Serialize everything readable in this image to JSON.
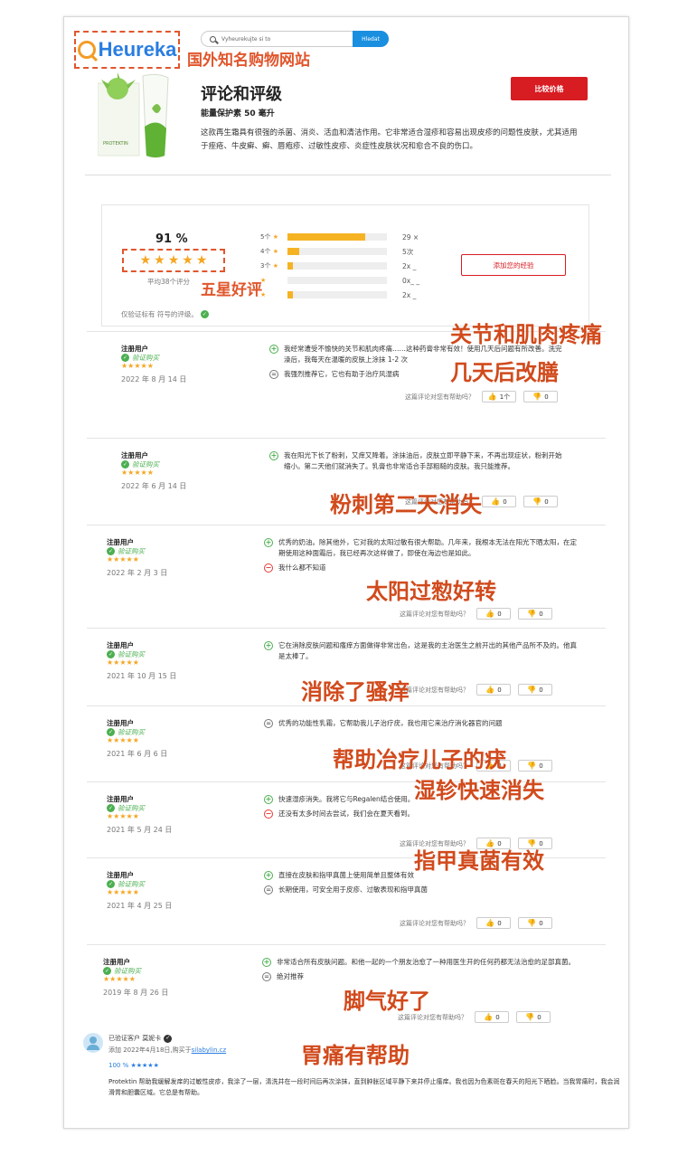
{
  "header": {
    "logo_text": "Heureka",
    "logo_annotation": "国外知名购物网站",
    "search_placeholder": "Vyheurekujte si to",
    "search_button": "Hledat",
    "title": "评论和评级",
    "subtitle": "能量保护素 50 毫升",
    "description": "这款再生霜具有很强的杀菌、消炎、活血和清洁作用。它非常适合湿疹和容易出现皮疹的问题性皮肤，尤其适用于痤疮、牛皮癣、癣、唇疱疹、过敏性皮疹、炎症性皮肤状况和愈合不良的伤口。",
    "compare_button": "比较价格",
    "product_label": "PROTEKTIN"
  },
  "summary": {
    "percent": "91 %",
    "stars_annotation": "五星好评",
    "average": "平均38个评分",
    "verified_note": "仅验证标有 符号的评级。",
    "add_button": "添加您的经验",
    "bars": [
      {
        "label": "5个",
        "fraction": 0.78,
        "count": "29 ×"
      },
      {
        "label": "4个",
        "fraction": 0.12,
        "count": "5次"
      },
      {
        "label": "3个",
        "fraction": 0.05,
        "count": "2x _"
      },
      {
        "label": "",
        "fraction": 0.0,
        "count": "0x_ _"
      },
      {
        "label": "",
        "fraction": 0.05,
        "count": "2x _"
      }
    ]
  },
  "helpful_question": "这篇评论对您有帮助吗？",
  "reviews": [
    {
      "user": "注册用户",
      "verified": "验证购买",
      "stars": "★★★★★",
      "date": "2022 年 8 月 14 日",
      "lines": [
        {
          "type": "plus",
          "text": "我经常遭受不愉快的关节和肌肉疼痛……这种药膏非常有效！使用几天后问题有所改善。洗完澡后，我每天在温暖的皮肤上涂抹 1-2 次"
        },
        {
          "type": "eq",
          "text": "我强烈推荐它，它也有助于治疗风湿病"
        }
      ],
      "up": "1个",
      "down": "0"
    },
    {
      "user": "注册用户",
      "verified": "验证购买",
      "stars": "★★★★★",
      "date": "2022 年 6 月 14 日",
      "lines": [
        {
          "type": "plus",
          "text": "我在阳光下长了粉刺，又痒又降着。涂抹油后，皮肤立即平静下来，不再出现症状，粉刺开始缩小。第二天他们就消失了。乳膏也非常适合手部粗糙的皮肤。我只能推荐。"
        }
      ],
      "up": "0",
      "down": "0"
    },
    {
      "user": "注册用户",
      "verified": "验证购买",
      "stars": "★★★★★",
      "date": "2022 年 2 月 3 日",
      "lines": [
        {
          "type": "plus",
          "text": "优秀的奶油。除其他外，它对我的太阳过敏有很大帮助。几年来，我根本无法在阳光下晒太阳，在定期使用这种面霜后，我已经再次这样做了，即使在海边也是如此。"
        },
        {
          "type": "minus",
          "text": "我什么都不知道"
        }
      ],
      "up": "0",
      "down": "0"
    },
    {
      "user": "注册用户",
      "verified": "验证购买",
      "stars": "★★★★★",
      "date": "2021 年 10 月 15 日",
      "lines": [
        {
          "type": "plus",
          "text": "它在消除皮肤问题和瘙痒方面做得非常出色，这是我的主治医生之前开出的其他产品所不及的。他真是太棒了。"
        }
      ],
      "up": "0",
      "down": "0"
    },
    {
      "user": "注册用户",
      "verified": "验证购买",
      "stars": "★★★★★",
      "date": "2021 年 6 月 6 日",
      "lines": [
        {
          "type": "eq",
          "text": "优秀的功能性乳霜，它帮助我儿子治疗疣，我也用它来治疗消化器官的问题"
        }
      ],
      "up": "0",
      "down": "0"
    },
    {
      "user": "注册用户",
      "verified": "验证购买",
      "stars": "★★★★★",
      "date": "2021 年 5 月 24 日",
      "lines": [
        {
          "type": "plus",
          "text": "快速湿疹消失。我将它与Regalen结合使用。"
        },
        {
          "type": "minus",
          "text": "还没有太多时间去尝试，我们会在夏天看到。"
        }
      ],
      "up": "0",
      "down": "0"
    },
    {
      "user": "注册用户",
      "verified": "验证购买",
      "stars": "★★★★★",
      "date": "2021 年 4 月 25 日",
      "lines": [
        {
          "type": "plus",
          "text": "直接在皮肤和指甲真菌上使用简单且整体有效"
        },
        {
          "type": "eq",
          "text": "长期使用，可安全用于皮疹、过敏表现和指甲真菌"
        }
      ],
      "up": "0",
      "down": "0"
    },
    {
      "user": "注册用户",
      "verified": "验证购买",
      "stars": "★★★★★",
      "date": "2019 年 8 月 26 日",
      "lines": [
        {
          "type": "plus",
          "text": "非常适合所有皮肤问题。和他一起的一个朋友治愈了一种用医生开的任何药都无法治愈的足部真菌。"
        },
        {
          "type": "eq",
          "text": "绝对推荐"
        }
      ],
      "up": "0",
      "down": "0"
    }
  ],
  "annotations": [
    "关节和肌肉疼痛",
    "几天后改膳",
    "粉刺第二天消失",
    "太阳过愸好转",
    "消除了骚痒",
    "帮助冶疗儿子的疣",
    "湿轸快速消失",
    "指甲真菌有效",
    "脚气好了",
    "胃痛有帮助"
  ],
  "last_review": {
    "user": "已验证客户 莫妮卡",
    "meta_prefix": "添加 2022年4月18日,购买于",
    "meta_link": "silabylin.cz",
    "percent": "100 %",
    "stars": "★★★★★",
    "text": "Protektin 帮助我缓解发痒的过敏性皮疹，我涂了一层，清洗并在一段时间后再次涂抹，直到肿胀区域平静下来并停止瘙痒。我也因为色素斑在春天的阳光下晒脸。当我胃痛时，我会润滑胃和胆囊区域。它总是有帮助。"
  }
}
